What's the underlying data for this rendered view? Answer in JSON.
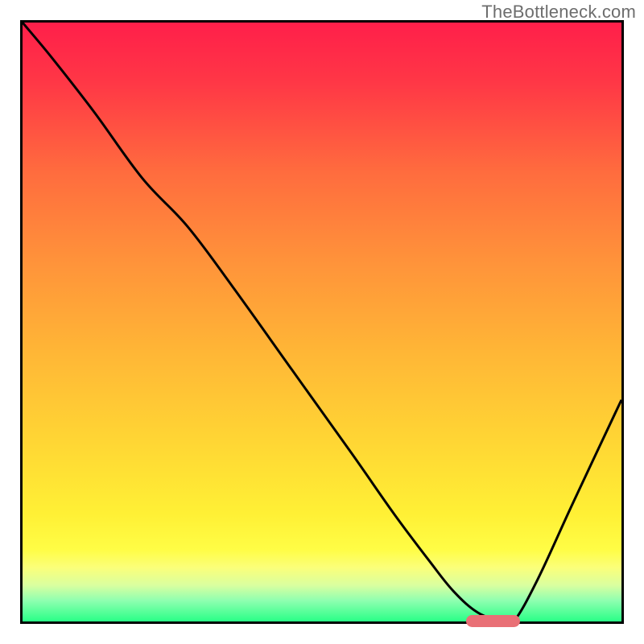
{
  "watermark": "TheBottleneck.com",
  "colors": {
    "gradient_stops": [
      {
        "offset": 0.0,
        "color": "#ff1f4a"
      },
      {
        "offset": 0.1,
        "color": "#ff3746"
      },
      {
        "offset": 0.25,
        "color": "#ff6c3e"
      },
      {
        "offset": 0.4,
        "color": "#ff933a"
      },
      {
        "offset": 0.55,
        "color": "#ffb636"
      },
      {
        "offset": 0.7,
        "color": "#ffd634"
      },
      {
        "offset": 0.82,
        "color": "#fff035"
      },
      {
        "offset": 0.88,
        "color": "#fffd45"
      },
      {
        "offset": 0.91,
        "color": "#fbff7a"
      },
      {
        "offset": 0.94,
        "color": "#d9ffa0"
      },
      {
        "offset": 0.965,
        "color": "#8fffb0"
      },
      {
        "offset": 1.0,
        "color": "#29ff87"
      }
    ],
    "marker": "#e97076",
    "curve": "#000000"
  },
  "chart_data": {
    "type": "line",
    "title": "",
    "xlabel": "",
    "ylabel": "",
    "xlim": [
      0,
      100
    ],
    "ylim": [
      0,
      100
    ],
    "series": [
      {
        "name": "bottleneck-curve",
        "x": [
          0,
          5,
          12,
          20,
          27.5,
          35,
          45,
          55,
          62,
          68,
          72,
          76,
          80,
          82,
          86,
          92,
          100
        ],
        "y": [
          100,
          94,
          85,
          74,
          66,
          56,
          42,
          28,
          18,
          10,
          5,
          1.5,
          0,
          0,
          7,
          20,
          37
        ]
      }
    ],
    "marker": {
      "x_start": 74,
      "x_end": 83,
      "y": 0
    }
  }
}
